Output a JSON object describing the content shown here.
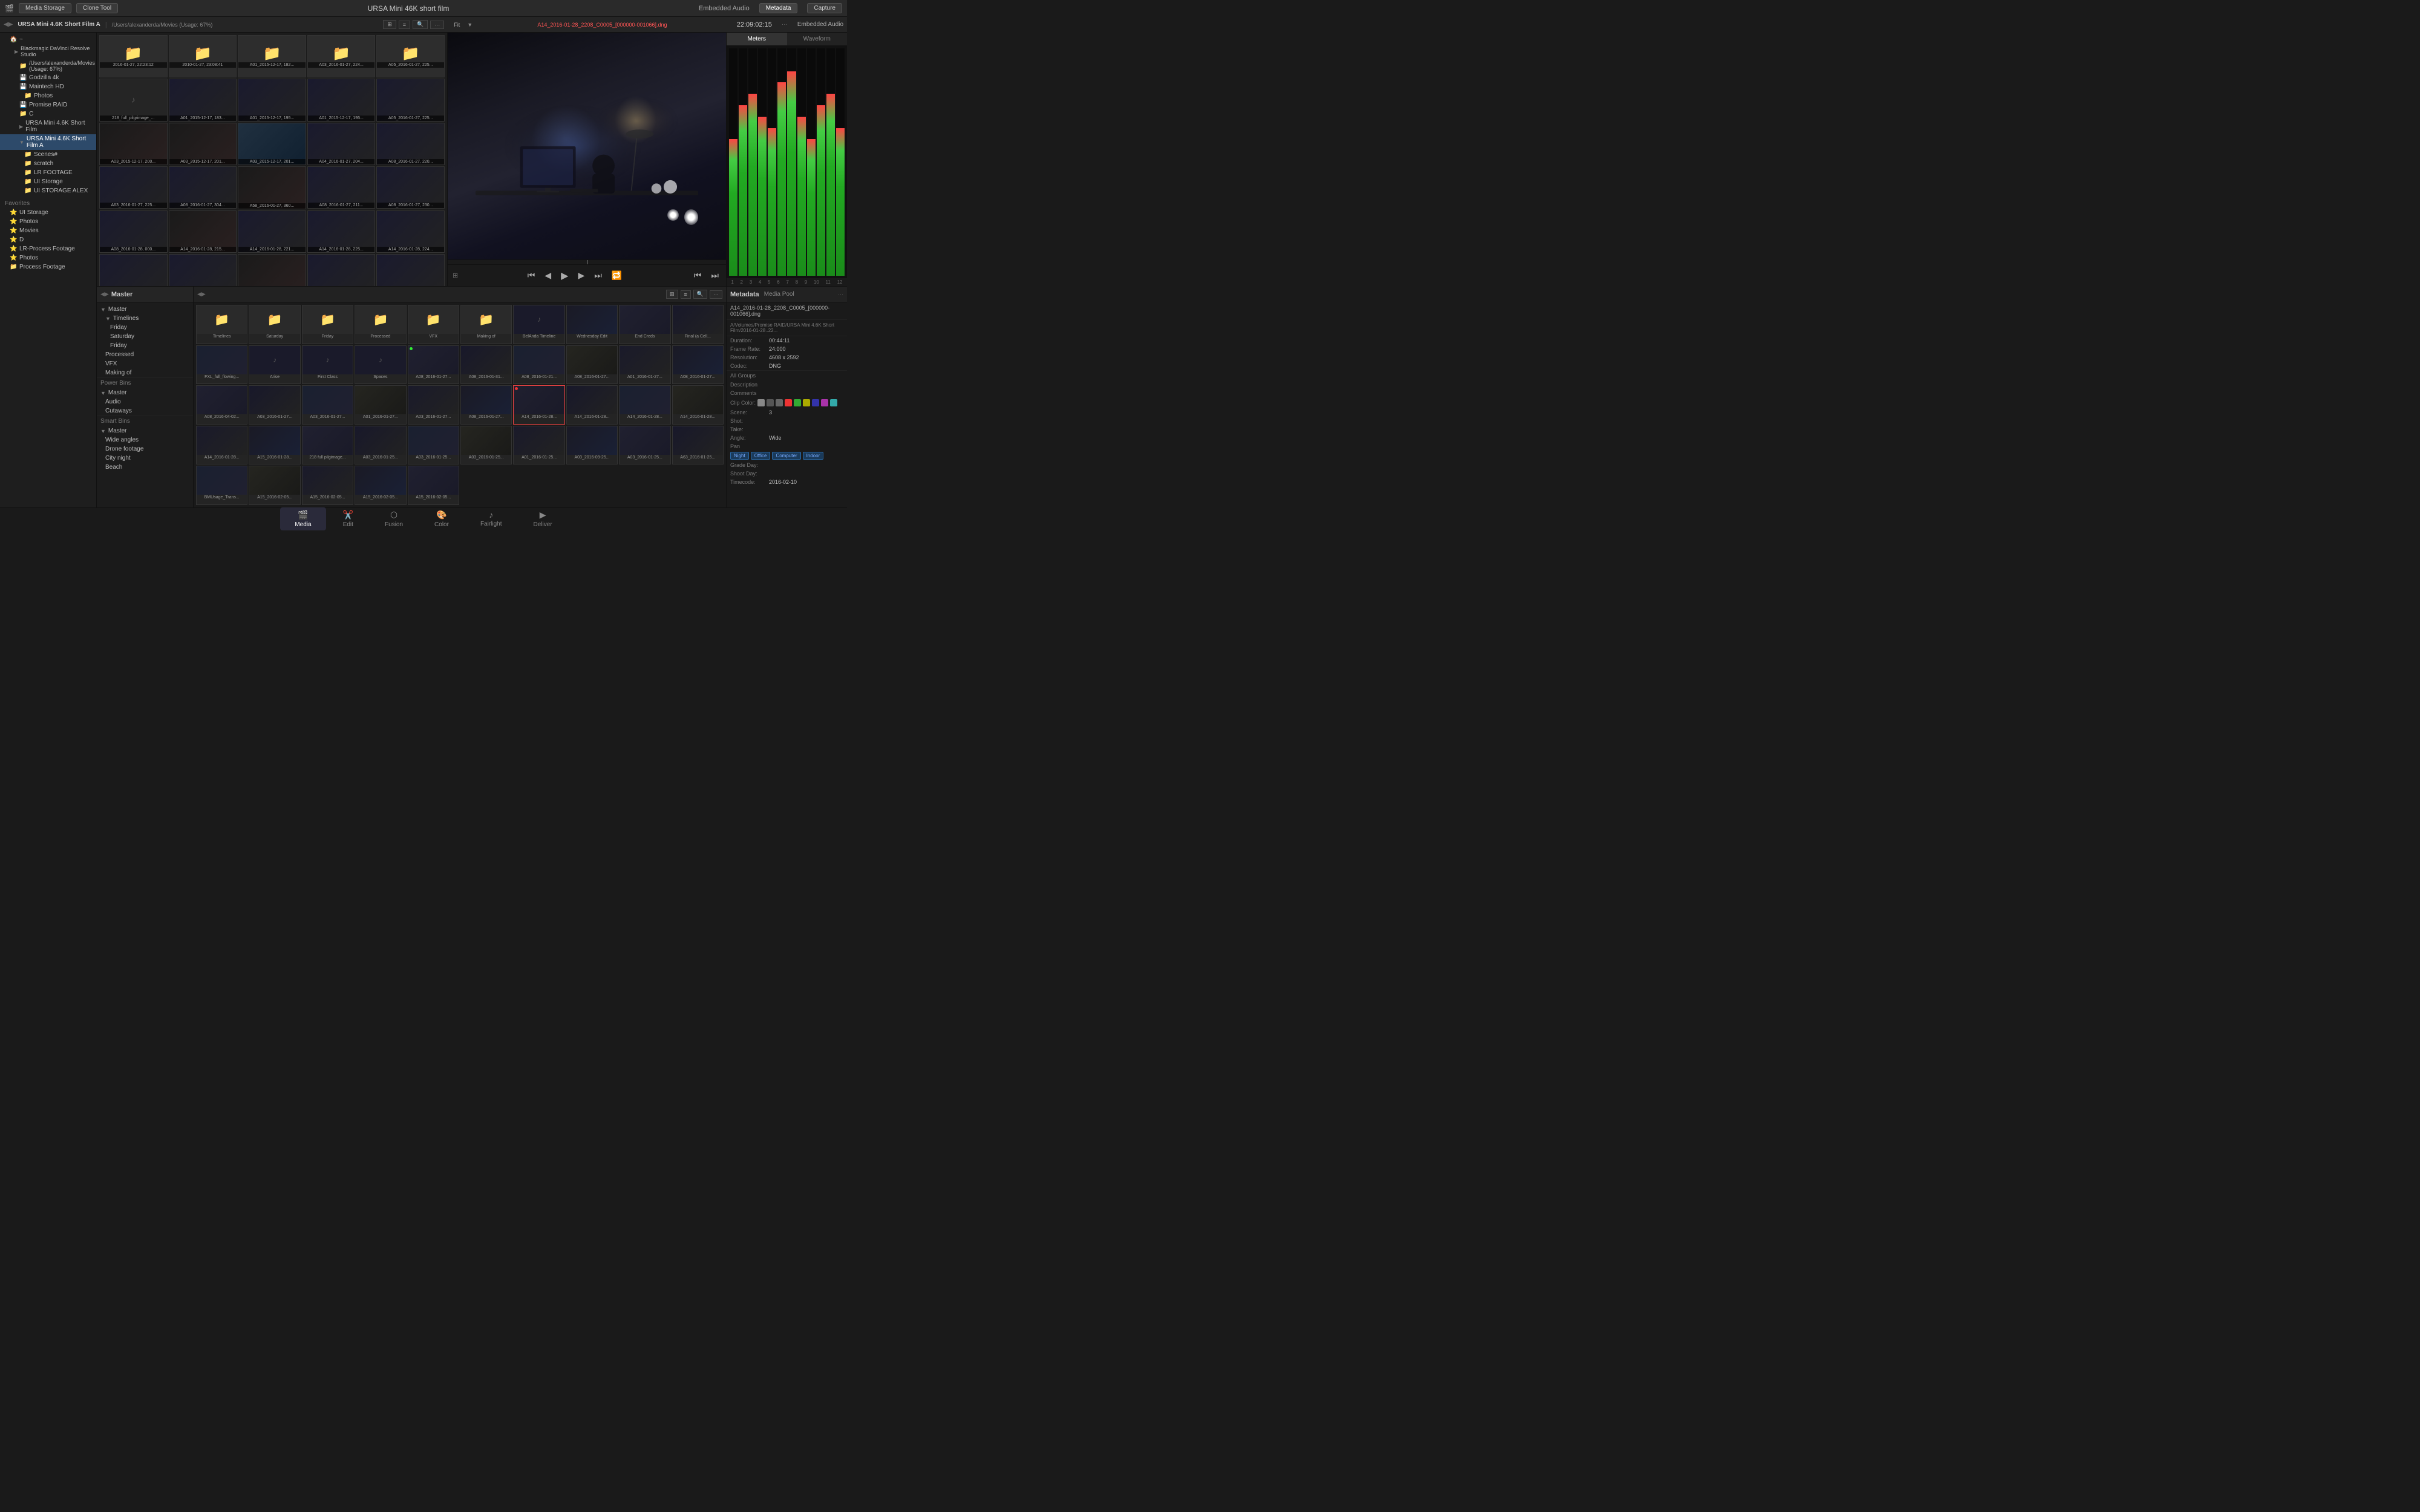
{
  "app": {
    "title": "URSA Mini 46K short film",
    "module": "Media Storage",
    "clone_tool": "Clone Tool"
  },
  "top_bar": {
    "drive_label": "URSA Mini 4.6K Short Film A",
    "path": "/Users/alexanderda/Movies (Usage: 67%)",
    "filename": "A14_2016-01-28_2208_C0005_[000000-001066].dng",
    "timecode": "22:09:02:15",
    "audio_label": "Embedded Audio",
    "meters_label": "Meters",
    "waveform_label": "Waveform"
  },
  "sidebar": {
    "drives": [
      {
        "label": "Blackmagic DaVinci Resolve Studio",
        "indent": 1
      },
      {
        "label": "/Users/alexanderda/Movies (Usage: 67%)",
        "indent": 2
      },
      {
        "label": "Godzilla 4k",
        "indent": 2
      },
      {
        "label": "Maintech HD",
        "indent": 2
      },
      {
        "label": "Photos",
        "indent": 3
      },
      {
        "label": "Promise RAID",
        "indent": 2
      },
      {
        "label": "C",
        "indent": 2
      },
      {
        "label": "URSA Mini 4.6K Short Film",
        "indent": 2
      },
      {
        "label": "URSA Mini 4.6K Short Film A",
        "indent": 2,
        "selected": true
      },
      {
        "label": "Scenes#",
        "indent": 3
      },
      {
        "label": "scratch",
        "indent": 3
      },
      {
        "label": "LR FOOTAGE",
        "indent": 3
      },
      {
        "label": "UI Storage",
        "indent": 3
      },
      {
        "label": "UI STORAGE ALEX",
        "indent": 3
      }
    ],
    "favorites": {
      "header": "Favorites",
      "items": [
        {
          "label": "UI Storage"
        },
        {
          "label": "Photos"
        },
        {
          "label": "Movies"
        },
        {
          "label": "D"
        },
        {
          "label": "LR-Process Footage"
        },
        {
          "label": "Photos"
        }
      ]
    }
  },
  "media_folders": [
    {
      "label": "2016-01-27, 22:23:12",
      "type": "folder"
    },
    {
      "label": "2010-01-27, 23:08:41",
      "type": "folder"
    },
    {
      "label": "A01_2015-12-17, 182...",
      "type": "folder"
    },
    {
      "label": "A03_2016-01-27, 224...",
      "type": "folder"
    },
    {
      "label": "A05_2016-01-27, 225...",
      "type": "folder"
    }
  ],
  "pool_tree": {
    "master": "Master",
    "timelines_header": "Timelines",
    "timelines": [
      {
        "label": "Friday"
      },
      {
        "label": "Saturday"
      },
      {
        "label": "Friday"
      }
    ],
    "processed": "Processed",
    "vfx": "VFX",
    "making_of": "Making of",
    "power_bins": {
      "header": "Power Bins",
      "master": "Master",
      "audio": "Audio",
      "cutaways": "Cutaways"
    },
    "smart_bins": {
      "header": "Smart Bins",
      "items": [
        {
          "label": "Wide angles"
        },
        {
          "label": "Drone footage"
        },
        {
          "label": "City night"
        },
        {
          "label": "Beach"
        }
      ]
    }
  },
  "pool_clips": [
    {
      "label": "Timelines",
      "type": "folder"
    },
    {
      "label": "Saturday",
      "type": "folder"
    },
    {
      "label": "Friday",
      "type": "folder"
    },
    {
      "label": "Processed",
      "type": "folder"
    },
    {
      "label": "VFX",
      "type": "folder"
    },
    {
      "label": "Making of",
      "type": "folder"
    },
    {
      "label": "BelAnda Timeline",
      "type": "clip",
      "hasNote": true
    },
    {
      "label": "Wednesday Edit",
      "type": "clip"
    },
    {
      "label": "End Creds",
      "type": "clip"
    },
    {
      "label": "Final (a Cell...",
      "type": "clip"
    },
    {
      "label": "FXL_full_flowing...",
      "type": "clip"
    },
    {
      "label": "Arise",
      "type": "clip",
      "hasNote": true
    },
    {
      "label": "First Class",
      "type": "clip",
      "hasNote": true
    },
    {
      "label": "Spaces",
      "type": "clip",
      "hasNote": true
    },
    {
      "label": "A08_2016-01-27...",
      "type": "clip",
      "dot": "green"
    },
    {
      "label": "A08_2016-01-31...",
      "type": "clip"
    },
    {
      "label": "A08_2016-01-21...",
      "type": "clip"
    },
    {
      "label": "A08_2016-01-27...",
      "type": "clip"
    },
    {
      "label": "A01_2016-01-27...",
      "type": "clip"
    },
    {
      "label": "A08_2016-01-27...",
      "type": "clip"
    },
    {
      "label": "A08_2016-04-02...",
      "type": "clip"
    },
    {
      "label": "A03_2016-01-27...",
      "type": "clip"
    },
    {
      "label": "A03_2016-01-27...",
      "type": "clip"
    },
    {
      "label": "A01_2016-01-27...",
      "type": "clip"
    },
    {
      "label": "A03_2016-01-27...",
      "type": "clip"
    },
    {
      "label": "A08_2016-01-27...",
      "type": "clip"
    },
    {
      "label": "A14_2016-01-28...",
      "type": "clip",
      "dot": "red",
      "selected": true
    },
    {
      "label": "A14_2016-01-28...",
      "type": "clip"
    },
    {
      "label": "A14_2016-01-28...",
      "type": "clip"
    },
    {
      "label": "A14_2016-01-28...",
      "type": "clip"
    },
    {
      "label": "A14_2016-01-28...",
      "type": "clip"
    },
    {
      "label": "A15_2016-01-28...",
      "type": "clip"
    },
    {
      "label": "218 full pilgimage...",
      "type": "clip"
    },
    {
      "label": "A03_2016-01-25...",
      "type": "clip"
    },
    {
      "label": "A03_2016-01-25...",
      "type": "clip"
    },
    {
      "label": "A03_2016-01-25...",
      "type": "clip"
    },
    {
      "label": "A01_2016-01-25...",
      "type": "clip"
    },
    {
      "label": "A03_2016-09-25...",
      "type": "clip"
    },
    {
      "label": "A03_2016-01-25...",
      "type": "clip"
    },
    {
      "label": "A63_2016-01-25...",
      "type": "clip"
    },
    {
      "label": "BMUsage_Trans...",
      "type": "clip"
    },
    {
      "label": "A15_2016-02-05...",
      "type": "clip"
    },
    {
      "label": "A15_2016-02-05...",
      "type": "clip"
    },
    {
      "label": "A15_2016-02-05...",
      "type": "clip"
    },
    {
      "label": "A15_2016-02-05...",
      "type": "clip"
    }
  ],
  "metadata": {
    "header": "Metadata",
    "pool_label": "Media Pool",
    "filename": "A14_2016-01-28_2208_C0005_[000000-001066].dng",
    "path": "A/Volumes/Promise RAID/URSA Mini 4.6K Short Film/2016-01-28..22...",
    "fields": [
      {
        "label": "Duration:",
        "value": "00:44:11"
      },
      {
        "label": "Frame Rate:",
        "value": "24:000"
      },
      {
        "label": "Resolution:",
        "value": "4608 x 2592"
      },
      {
        "label": "Codec:",
        "value": "DNG"
      }
    ],
    "all_groups": "All Groups",
    "description_label": "Description",
    "comments_label": "Comments",
    "clip_color_label": "Clip Color:",
    "clip_colors": [
      "#888",
      "#555",
      "#666",
      "#e33",
      "#3a3",
      "#aa0",
      "#33a",
      "#a3a",
      "#3aa"
    ],
    "scene_label": "Scene:",
    "scene_value": "3",
    "shot_label": "Shot:",
    "take_label": "Take:",
    "angle_label": "Angle:",
    "angle_value": "Wide",
    "pan_label": "Pan",
    "location_tags": [
      "Night",
      "Office",
      "Computer",
      "Indoor"
    ],
    "grade_day_label": "Grade Day:",
    "shoot_day_label": "Shoot Day:",
    "timecode_label": "Timecode:",
    "timecode_value": "2016-02-10"
  },
  "meters": {
    "label": "Meters",
    "channels": [
      1,
      2,
      3,
      4,
      5,
      6,
      7,
      8,
      9,
      10,
      11,
      12
    ],
    "levels": [
      60,
      75,
      80,
      70,
      65,
      85,
      90,
      70,
      60,
      75,
      80,
      65
    ],
    "labels": [
      "1",
      "2",
      "3",
      "4",
      "5",
      "6",
      "7",
      "8",
      "9",
      "10",
      "11",
      "12"
    ]
  },
  "bottom_nav": {
    "tabs": [
      {
        "label": "Media",
        "active": true,
        "icon": "🎬"
      },
      {
        "label": "Edit",
        "active": false,
        "icon": "✂️"
      },
      {
        "label": "Fusion",
        "active": false,
        "icon": "⬡"
      },
      {
        "label": "Color",
        "active": false,
        "icon": "🎨"
      },
      {
        "label": "Fairlight",
        "active": false,
        "icon": "♪"
      },
      {
        "label": "Deliver",
        "active": false,
        "icon": "▶"
      }
    ]
  }
}
